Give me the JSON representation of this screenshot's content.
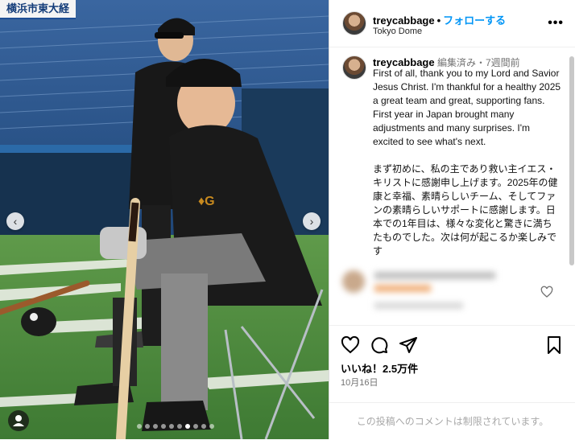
{
  "photo": {
    "banner_text": "横浜市東大経",
    "nav_left": "‹",
    "nav_right": "›",
    "carousel_total": 10,
    "carousel_active_index": 6
  },
  "header": {
    "username": "treycabbage",
    "separator": "•",
    "follow_label": "フォローする",
    "location": "Tokyo Dome",
    "more_label": "•••"
  },
  "caption": {
    "username": "treycabbage",
    "meta": "編集済み・7週間前",
    "paragraph_en": "First of all, thank you to my Lord and Savior Jesus Christ. I'm thankful for a healthy 2025 a great team and great, supporting fans. First year in Japan brought many adjustments and many surprises. I'm excited to see what's next.",
    "paragraph_ja": "まず初めに、私の主であり救い主イエス・キリストに感謝申し上げます。2025年の健康と幸福、素晴らしいチーム、そしてファンの素晴らしいサポートに感謝します。日本での1年目は、様々な変化と驚きに満ちたものでした。次は何が起こるか楽しみです"
  },
  "actions": {
    "likes": "いいね！2.5万件",
    "date": "10月16日"
  },
  "comments": {
    "restricted_text": "この投稿へのコメントは制限されています。"
  },
  "colors": {
    "follow": "#0095f6",
    "muted": "#737373",
    "divider": "#efefef"
  }
}
